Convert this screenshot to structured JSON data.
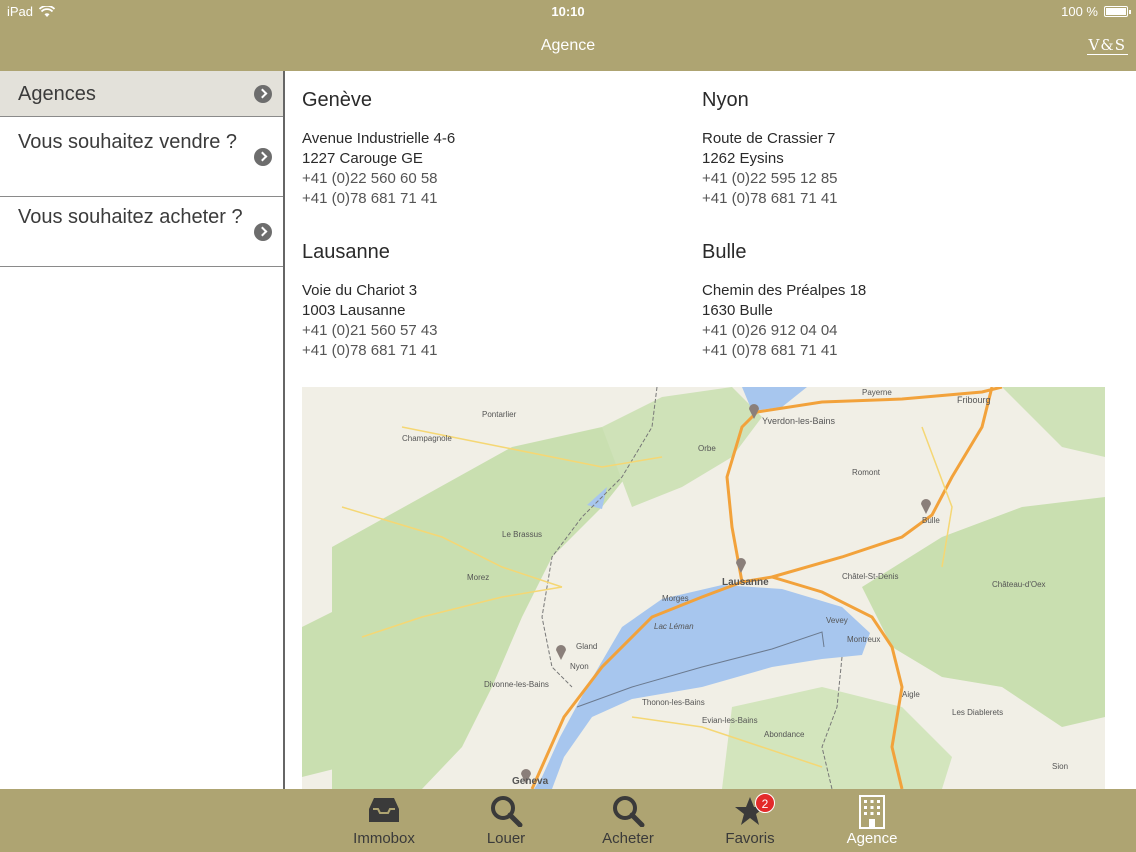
{
  "status_bar": {
    "device": "iPad",
    "time": "10:10",
    "battery": "100 %"
  },
  "header": {
    "title": "Agence",
    "logo_text": "V&S"
  },
  "sidebar": {
    "items": [
      {
        "label": "Agences",
        "active": true
      },
      {
        "label": "Vous souhaitez vendre ?",
        "active": false
      },
      {
        "label": "Vous souhaitez acheter ?",
        "active": false
      }
    ]
  },
  "agencies": [
    {
      "city": "Genève",
      "street": "Avenue Industrielle 4-6",
      "zip_city": "1227 Carouge GE",
      "phone1": "+41 (0)22 560 60 58",
      "phone2": "+41 (0)78 681 71 41"
    },
    {
      "city": "Nyon",
      "street": "Route de Crassier 7",
      "zip_city": "1262 Eysins",
      "phone1": "+41 (0)22 595 12 85",
      "phone2": "+41 (0)78 681 71 41"
    },
    {
      "city": "Lausanne",
      "street": "Voie du Chariot 3",
      "zip_city": "1003 Lausanne",
      "phone1": "+41 (0)21 560 57 43",
      "phone2": "+41 (0)78 681 71 41"
    },
    {
      "city": "Bulle",
      "street": "Chemin des Préalpes 18",
      "zip_city": "1630 Bulle",
      "phone1": "+41 (0)26 912 04 04",
      "phone2": "+41 (0)78 681 71 41"
    }
  ],
  "map": {
    "labels": [
      "Yverdon-les-Bains",
      "Lausanne",
      "Bulle",
      "Geneva",
      "Montreux",
      "Fribourg",
      "Thonon-les-Bains",
      "Evian-les-Bains",
      "Nyon",
      "Morges",
      "Vevey",
      "Romont",
      "Châtel-St-Denis",
      "Payerne",
      "Champagnole",
      "Morez",
      "Gland",
      "Divonne-les-Bains",
      "Abondance",
      "Les Diablerets",
      "Aigle",
      "Château-d'Oex",
      "Le Brassus",
      "Orbe",
      "Pontarlier",
      "Sion",
      "Lac Léman"
    ],
    "colors": {
      "land": "#f1efe6",
      "forest": "#c9dfb0",
      "water": "#a7c6ee",
      "highway": "#f2a23b"
    }
  },
  "tabbar": {
    "tabs": [
      {
        "label": "Immobox",
        "icon": "inbox-icon",
        "active": false
      },
      {
        "label": "Louer",
        "icon": "search-icon",
        "active": false
      },
      {
        "label": "Acheter",
        "icon": "search-icon",
        "active": false
      },
      {
        "label": "Favoris",
        "icon": "star-icon",
        "active": false,
        "badge": "2"
      },
      {
        "label": "Agence",
        "icon": "building-icon",
        "active": true
      }
    ]
  }
}
